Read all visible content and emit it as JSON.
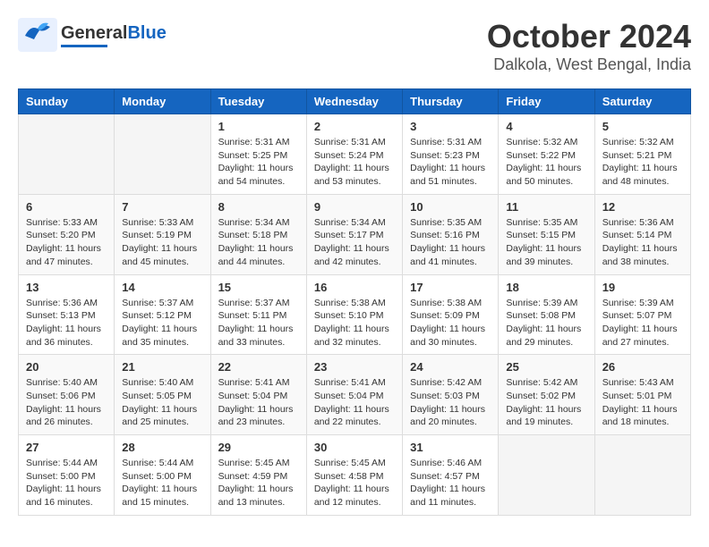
{
  "header": {
    "logo_general": "General",
    "logo_blue": "Blue",
    "title": "October 2024",
    "subtitle": "Dalkola, West Bengal, India"
  },
  "weekdays": [
    "Sunday",
    "Monday",
    "Tuesday",
    "Wednesday",
    "Thursday",
    "Friday",
    "Saturday"
  ],
  "weeks": [
    [
      {
        "day": "",
        "info": ""
      },
      {
        "day": "",
        "info": ""
      },
      {
        "day": "1",
        "info": "Sunrise: 5:31 AM\nSunset: 5:25 PM\nDaylight: 11 hours and 54 minutes."
      },
      {
        "day": "2",
        "info": "Sunrise: 5:31 AM\nSunset: 5:24 PM\nDaylight: 11 hours and 53 minutes."
      },
      {
        "day": "3",
        "info": "Sunrise: 5:31 AM\nSunset: 5:23 PM\nDaylight: 11 hours and 51 minutes."
      },
      {
        "day": "4",
        "info": "Sunrise: 5:32 AM\nSunset: 5:22 PM\nDaylight: 11 hours and 50 minutes."
      },
      {
        "day": "5",
        "info": "Sunrise: 5:32 AM\nSunset: 5:21 PM\nDaylight: 11 hours and 48 minutes."
      }
    ],
    [
      {
        "day": "6",
        "info": "Sunrise: 5:33 AM\nSunset: 5:20 PM\nDaylight: 11 hours and 47 minutes."
      },
      {
        "day": "7",
        "info": "Sunrise: 5:33 AM\nSunset: 5:19 PM\nDaylight: 11 hours and 45 minutes."
      },
      {
        "day": "8",
        "info": "Sunrise: 5:34 AM\nSunset: 5:18 PM\nDaylight: 11 hours and 44 minutes."
      },
      {
        "day": "9",
        "info": "Sunrise: 5:34 AM\nSunset: 5:17 PM\nDaylight: 11 hours and 42 minutes."
      },
      {
        "day": "10",
        "info": "Sunrise: 5:35 AM\nSunset: 5:16 PM\nDaylight: 11 hours and 41 minutes."
      },
      {
        "day": "11",
        "info": "Sunrise: 5:35 AM\nSunset: 5:15 PM\nDaylight: 11 hours and 39 minutes."
      },
      {
        "day": "12",
        "info": "Sunrise: 5:36 AM\nSunset: 5:14 PM\nDaylight: 11 hours and 38 minutes."
      }
    ],
    [
      {
        "day": "13",
        "info": "Sunrise: 5:36 AM\nSunset: 5:13 PM\nDaylight: 11 hours and 36 minutes."
      },
      {
        "day": "14",
        "info": "Sunrise: 5:37 AM\nSunset: 5:12 PM\nDaylight: 11 hours and 35 minutes."
      },
      {
        "day": "15",
        "info": "Sunrise: 5:37 AM\nSunset: 5:11 PM\nDaylight: 11 hours and 33 minutes."
      },
      {
        "day": "16",
        "info": "Sunrise: 5:38 AM\nSunset: 5:10 PM\nDaylight: 11 hours and 32 minutes."
      },
      {
        "day": "17",
        "info": "Sunrise: 5:38 AM\nSunset: 5:09 PM\nDaylight: 11 hours and 30 minutes."
      },
      {
        "day": "18",
        "info": "Sunrise: 5:39 AM\nSunset: 5:08 PM\nDaylight: 11 hours and 29 minutes."
      },
      {
        "day": "19",
        "info": "Sunrise: 5:39 AM\nSunset: 5:07 PM\nDaylight: 11 hours and 27 minutes."
      }
    ],
    [
      {
        "day": "20",
        "info": "Sunrise: 5:40 AM\nSunset: 5:06 PM\nDaylight: 11 hours and 26 minutes."
      },
      {
        "day": "21",
        "info": "Sunrise: 5:40 AM\nSunset: 5:05 PM\nDaylight: 11 hours and 25 minutes."
      },
      {
        "day": "22",
        "info": "Sunrise: 5:41 AM\nSunset: 5:04 PM\nDaylight: 11 hours and 23 minutes."
      },
      {
        "day": "23",
        "info": "Sunrise: 5:41 AM\nSunset: 5:04 PM\nDaylight: 11 hours and 22 minutes."
      },
      {
        "day": "24",
        "info": "Sunrise: 5:42 AM\nSunset: 5:03 PM\nDaylight: 11 hours and 20 minutes."
      },
      {
        "day": "25",
        "info": "Sunrise: 5:42 AM\nSunset: 5:02 PM\nDaylight: 11 hours and 19 minutes."
      },
      {
        "day": "26",
        "info": "Sunrise: 5:43 AM\nSunset: 5:01 PM\nDaylight: 11 hours and 18 minutes."
      }
    ],
    [
      {
        "day": "27",
        "info": "Sunrise: 5:44 AM\nSunset: 5:00 PM\nDaylight: 11 hours and 16 minutes."
      },
      {
        "day": "28",
        "info": "Sunrise: 5:44 AM\nSunset: 5:00 PM\nDaylight: 11 hours and 15 minutes."
      },
      {
        "day": "29",
        "info": "Sunrise: 5:45 AM\nSunset: 4:59 PM\nDaylight: 11 hours and 13 minutes."
      },
      {
        "day": "30",
        "info": "Sunrise: 5:45 AM\nSunset: 4:58 PM\nDaylight: 11 hours and 12 minutes."
      },
      {
        "day": "31",
        "info": "Sunrise: 5:46 AM\nSunset: 4:57 PM\nDaylight: 11 hours and 11 minutes."
      },
      {
        "day": "",
        "info": ""
      },
      {
        "day": "",
        "info": ""
      }
    ]
  ]
}
